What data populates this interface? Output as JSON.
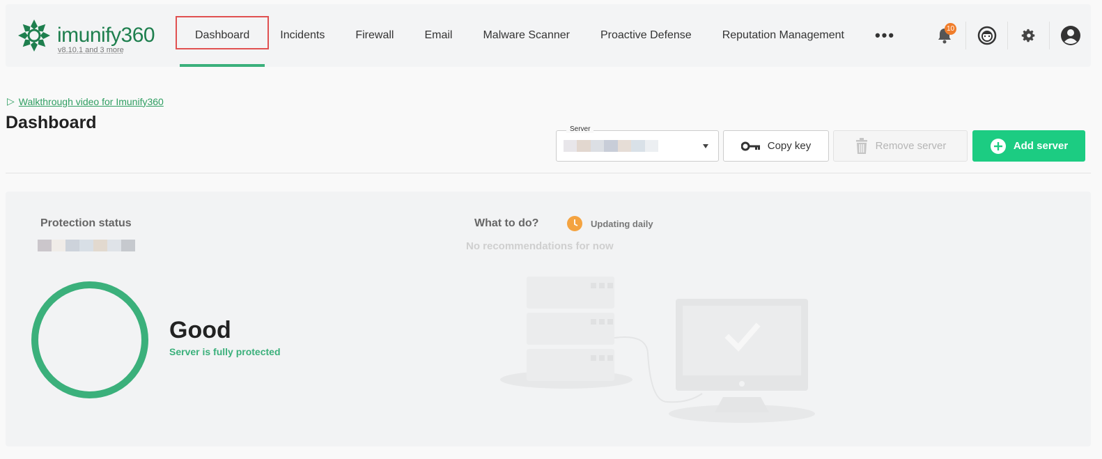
{
  "app": {
    "logo_text": "imunify",
    "logo_number": "360",
    "version": "v8.10.1 and 3 more"
  },
  "nav": {
    "items": [
      {
        "label": "Dashboard",
        "active": true
      },
      {
        "label": "Incidents"
      },
      {
        "label": "Firewall"
      },
      {
        "label": "Email"
      },
      {
        "label": "Malware Scanner"
      },
      {
        "label": "Proactive Defense"
      },
      {
        "label": "Reputation Management"
      }
    ],
    "more_label": "•••",
    "notifications_count": "10",
    "icons": [
      "bell-icon",
      "support-icon",
      "gear-icon",
      "user-icon"
    ]
  },
  "header": {
    "walkthrough_icon": "▷",
    "walkthrough": "Walkthrough video for Imunify360",
    "title": "Dashboard"
  },
  "toolbar": {
    "server_label": "Server",
    "copy_key": "Copy key",
    "remove_server": "Remove server",
    "add_server": "Add server"
  },
  "protection": {
    "title": "Protection status",
    "status": "Good",
    "status_text": "Server is fully protected"
  },
  "todo": {
    "title": "What to do?",
    "updating": "Updating daily",
    "empty": "No recommendations for now"
  },
  "colors": {
    "brand": "#1e7f4e",
    "accent": "#3bb07b",
    "add_button": "#1ccc82",
    "badge": "#f07d2b",
    "active_outline": "#e05050"
  }
}
